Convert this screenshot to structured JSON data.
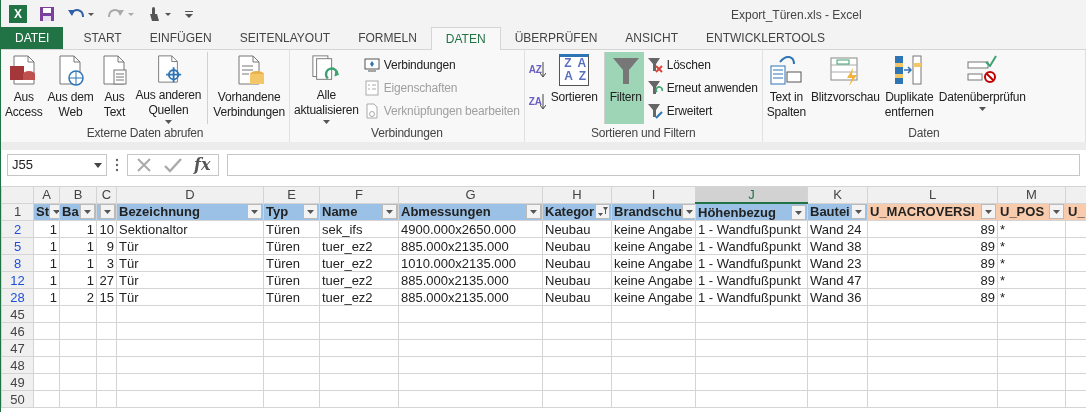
{
  "app_icon_text": "X",
  "window": {
    "title": "Export_Türen.xls - Excel"
  },
  "tabs": [
    {
      "label": "DATEI",
      "kind": "file",
      "selected": false
    },
    {
      "label": "START",
      "kind": "tab",
      "selected": false
    },
    {
      "label": "EINFÜGEN",
      "kind": "tab",
      "selected": false
    },
    {
      "label": "SEITENLAYOUT",
      "kind": "tab",
      "selected": false
    },
    {
      "label": "FORMELN",
      "kind": "tab",
      "selected": false
    },
    {
      "label": "DATEN",
      "kind": "tab",
      "selected": true
    },
    {
      "label": "ÜBERPRÜFEN",
      "kind": "tab",
      "selected": false
    },
    {
      "label": "ANSICHT",
      "kind": "tab",
      "selected": false
    },
    {
      "label": "ENTWICKLERTOOLS",
      "kind": "tab",
      "selected": false
    }
  ],
  "ribbon_groups": [
    {
      "label": "Externe Daten abrufen",
      "items": [
        {
          "kind": "large",
          "label": "Aus\nAccess",
          "disabled": false,
          "selected": false,
          "dropdown": false
        },
        {
          "kind": "large",
          "label": "Aus dem\nWeb",
          "disabled": false,
          "selected": false,
          "dropdown": false
        },
        {
          "kind": "large",
          "label": "Aus\nText",
          "disabled": false,
          "selected": false,
          "dropdown": false
        },
        {
          "kind": "large",
          "label": "Aus anderen\nQuellen",
          "disabled": false,
          "selected": false,
          "dropdown": true
        },
        {
          "kind": "large",
          "label": "Vorhandene\nVerbindungen",
          "disabled": false,
          "selected": false,
          "dropdown": false,
          "separator_before": true
        }
      ]
    },
    {
      "label": "Verbindungen",
      "items": [
        {
          "kind": "large",
          "label": "Alle\naktualisieren",
          "disabled": false,
          "selected": false,
          "dropdown": true
        },
        {
          "kind": "small",
          "label": "Verbindungen",
          "disabled": false,
          "selected": false,
          "dropdown": false
        },
        {
          "kind": "small",
          "label": "Eigenschaften",
          "disabled": true,
          "selected": false,
          "dropdown": false
        },
        {
          "kind": "small",
          "label": "Verknüpfungen bearbeiten",
          "disabled": true,
          "selected": false,
          "dropdown": false
        }
      ]
    },
    {
      "label": "Sortieren und Filtern",
      "items": [
        {
          "kind": "sort",
          "icon_text": "AZ",
          "disabled": false,
          "selected": false,
          "dropdown": false
        },
        {
          "kind": "sort",
          "icon_text": "ZA",
          "disabled": false,
          "selected": false,
          "dropdown": false
        },
        {
          "kind": "large",
          "label": "Sortieren",
          "icon_text": [
            "ZA",
            "AZ"
          ],
          "disabled": false,
          "selected": false,
          "dropdown": false
        },
        {
          "kind": "large",
          "label": "Filtern",
          "disabled": false,
          "selected": true,
          "dropdown": false,
          "separator_before": true
        },
        {
          "kind": "small",
          "label": "Löschen",
          "disabled": false,
          "selected": false,
          "dropdown": false
        },
        {
          "kind": "small",
          "label": "Erneut anwenden",
          "disabled": false,
          "selected": false,
          "dropdown": false
        },
        {
          "kind": "small",
          "label": "Erweitert",
          "disabled": false,
          "selected": false,
          "dropdown": false
        }
      ]
    },
    {
      "label": "Daten",
      "items": [
        {
          "kind": "large",
          "label": "Text in\nSpalten",
          "disabled": false,
          "selected": false,
          "dropdown": false
        },
        {
          "kind": "large",
          "label": "Blitzvorschau",
          "disabled": false,
          "selected": false,
          "dropdown": false
        },
        {
          "kind": "large",
          "label": "Duplikate\nentfernen",
          "disabled": false,
          "selected": false,
          "dropdown": false
        },
        {
          "kind": "large",
          "label": "Datenüberprüfun",
          "disabled": false,
          "selected": false,
          "dropdown": true
        }
      ]
    }
  ],
  "name_box": "J55",
  "formula_icon_text": "fx",
  "sheet": {
    "columns": [
      {
        "letter": "A",
        "header": "St",
        "color": "#9bc2e6",
        "filtered": false,
        "selected": false
      },
      {
        "letter": "B",
        "header": "Ba",
        "color": "#9bc2e6",
        "filtered": false,
        "selected": false
      },
      {
        "letter": "C",
        "color": "#9bc2e6",
        "filtered": false,
        "selected": false
      },
      {
        "letter": "D",
        "header": "Bezeichnung",
        "color": "#9bc2e6",
        "filtered": false,
        "selected": false
      },
      {
        "letter": "E",
        "header": "Typ",
        "color": "#9bc2e6",
        "filtered": false,
        "selected": false
      },
      {
        "letter": "F",
        "header": "Name",
        "color": "#9bc2e6",
        "filtered": false,
        "selected": false
      },
      {
        "letter": "G",
        "header": "Abmessungen",
        "color": "#9bc2e6",
        "filtered": false,
        "selected": false
      },
      {
        "letter": "H",
        "header": "Kategor",
        "color": "#9bc2e6",
        "filtered": true,
        "selected": false
      },
      {
        "letter": "I",
        "header": "Brandschu",
        "color": "#9bc2e6",
        "filtered": false,
        "selected": false
      },
      {
        "letter": "J",
        "header": "Höhenbezug",
        "color": "#9bc2e6",
        "filtered": false,
        "selected": true
      },
      {
        "letter": "K",
        "header": "Bautei",
        "color": "#9bc2e6",
        "filtered": false,
        "selected": false
      },
      {
        "letter": "L",
        "header": "U_MACROVERSI",
        "color": "#f8cbad",
        "filtered": false,
        "selected": false
      },
      {
        "letter": "M",
        "header": "U_POS",
        "color": "#f8cbad",
        "filtered": false,
        "selected": false
      },
      {
        "header": "U_",
        "color": "#f8cbad",
        "selected": false
      }
    ],
    "header_row_number": "1",
    "rows": [
      {
        "number": "2",
        "filtered": true,
        "cells": [
          "1",
          "1",
          "10",
          "Sektionaltor",
          "Türen",
          "sek_ifs",
          "4900.000x2650.000",
          "Neubau",
          "keine Angabe",
          "1 - Wandfußpunkt",
          "Wand 24",
          "89",
          "*"
        ]
      },
      {
        "number": "5",
        "filtered": true,
        "cells": [
          "1",
          "1",
          "9",
          "Tür",
          "Türen",
          "tuer_ez2",
          "885.000x2135.000",
          "Neubau",
          "keine Angabe",
          "1 - Wandfußpunkt",
          "Wand 38",
          "89",
          "*"
        ]
      },
      {
        "number": "8",
        "filtered": true,
        "cells": [
          "1",
          "1",
          "3",
          "Tür",
          "Türen",
          "tuer_ez2",
          "1010.000x2135.000",
          "Neubau",
          "keine Angabe",
          "1 - Wandfußpunkt",
          "Wand 23",
          "89",
          "*"
        ]
      },
      {
        "number": "12",
        "filtered": true,
        "cells": [
          "1",
          "1",
          "27",
          "Tür",
          "Türen",
          "tuer_ez2",
          "885.000x2135.000",
          "Neubau",
          "keine Angabe",
          "1 - Wandfußpunkt",
          "Wand 47",
          "89",
          "*"
        ]
      },
      {
        "number": "28",
        "filtered": true,
        "cells": [
          "1",
          "2",
          "15",
          "Tür",
          "Türen",
          "tuer_ez2",
          "885.000x2135.000",
          "Neubau",
          "keine Angabe",
          "1 - Wandfußpunkt",
          "Wand 36",
          "89",
          "*"
        ]
      },
      {
        "number": "45",
        "filtered": false,
        "cells": []
      },
      {
        "number": "46",
        "filtered": false,
        "cells": []
      },
      {
        "number": "47",
        "filtered": false,
        "cells": []
      },
      {
        "number": "48",
        "filtered": false,
        "cells": []
      },
      {
        "number": "49",
        "filtered": false,
        "cells": []
      },
      {
        "number": "50",
        "filtered": false,
        "cells": []
      }
    ]
  }
}
